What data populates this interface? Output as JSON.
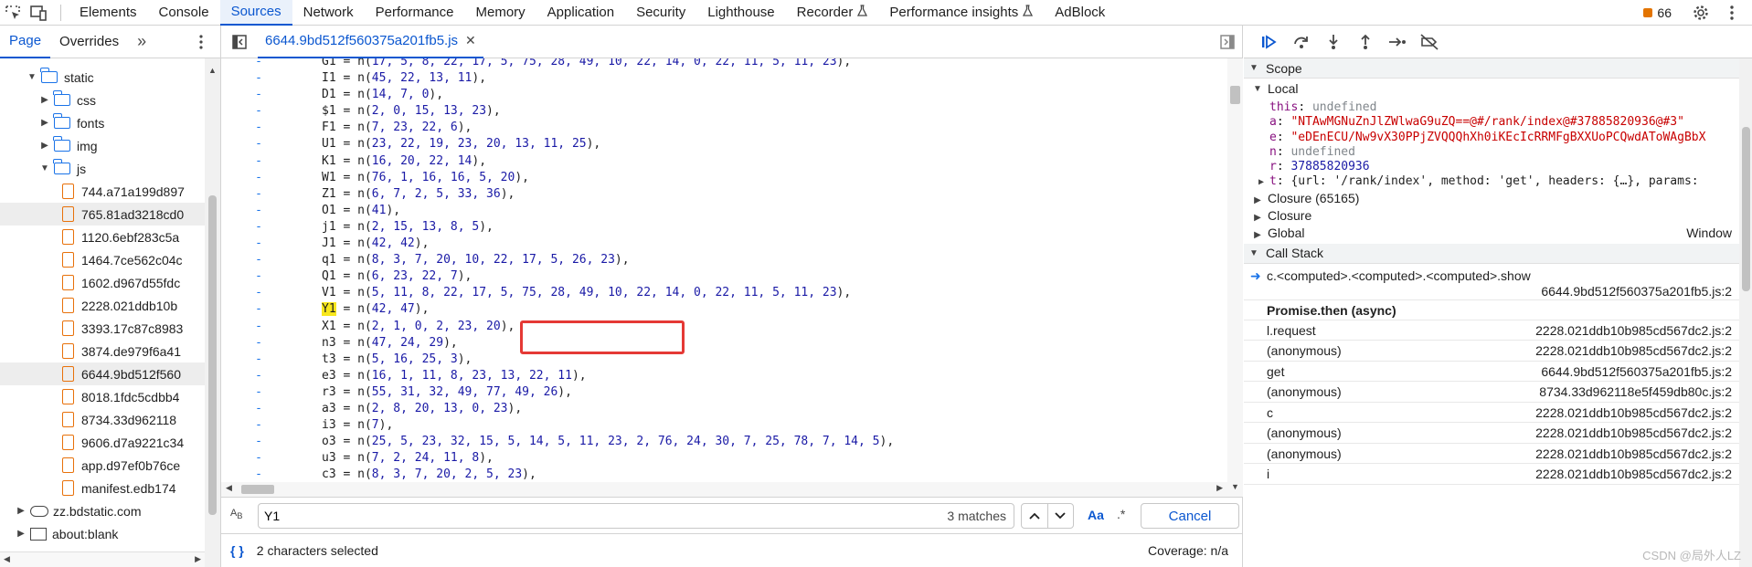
{
  "topbar": {
    "tabs": [
      "Elements",
      "Console",
      "Sources",
      "Network",
      "Performance",
      "Memory",
      "Application",
      "Security",
      "Lighthouse",
      "Recorder",
      "Performance insights",
      "AdBlock"
    ],
    "active_tab": "Sources",
    "issues_count": "66",
    "icons": [
      "inspect-element-icon",
      "device-toolbar-icon",
      "flask-icon",
      "gear-icon",
      "kebab-menu-icon"
    ]
  },
  "navigator": {
    "tabs": [
      "Page",
      "Overrides"
    ],
    "active_tab": "Page",
    "tree": [
      {
        "label": "static",
        "type": "folder",
        "depth": 1,
        "expanded": true
      },
      {
        "label": "css",
        "type": "folder",
        "depth": 2,
        "expanded": false
      },
      {
        "label": "fonts",
        "type": "folder",
        "depth": 2,
        "expanded": false
      },
      {
        "label": "img",
        "type": "folder",
        "depth": 2,
        "expanded": false
      },
      {
        "label": "js",
        "type": "folder",
        "depth": 2,
        "expanded": true
      },
      {
        "label": "744.a71a199d897",
        "type": "file",
        "depth": 3
      },
      {
        "label": "765.81ad3218cd0",
        "type": "file",
        "depth": 3,
        "highlight": true
      },
      {
        "label": "1120.6ebf283c5a",
        "type": "file",
        "depth": 3
      },
      {
        "label": "1464.7ce562c04c",
        "type": "file",
        "depth": 3
      },
      {
        "label": "1602.d967d55fdc",
        "type": "file",
        "depth": 3
      },
      {
        "label": "2228.021ddb10b",
        "type": "file",
        "depth": 3
      },
      {
        "label": "3393.17c87c8983",
        "type": "file",
        "depth": 3
      },
      {
        "label": "3874.de979f6a41",
        "type": "file",
        "depth": 3
      },
      {
        "label": "6644.9bd512f560",
        "type": "file",
        "depth": 3,
        "highlight": true
      },
      {
        "label": "8018.1fdc5cdbb4",
        "type": "file",
        "depth": 3
      },
      {
        "label": "8734.33d962118",
        "type": "file",
        "depth": 3
      },
      {
        "label": "9606.d7a9221c34",
        "type": "file",
        "depth": 3
      },
      {
        "label": "app.d97ef0b76ce",
        "type": "file",
        "depth": 3
      },
      {
        "label": "manifest.edb174",
        "type": "file",
        "depth": 3
      },
      {
        "label": "zz.bdstatic.com",
        "type": "cloud",
        "depth": 0,
        "expanded": false
      },
      {
        "label": "about:blank",
        "type": "frame",
        "depth": 0,
        "expanded": false
      }
    ]
  },
  "editor": {
    "file_tab": "6644.9bd512f560375a201fb5.js",
    "code_lines": [
      {
        "name": "G1",
        "args": "17, 5, 8, 22, 17, 5, 75, 28, 49, 10, 22, 14, 0, 22, 11, 5, 11, 23"
      },
      {
        "name": "I1",
        "args": "45, 22, 13, 11"
      },
      {
        "name": "D1",
        "args": "14, 7, 0"
      },
      {
        "name": "$1",
        "args": "2, 0, 15, 13, 23"
      },
      {
        "name": "F1",
        "args": "7, 23, 22, 6"
      },
      {
        "name": "U1",
        "args": "23, 22, 19, 23, 20, 13, 11, 25"
      },
      {
        "name": "K1",
        "args": "16, 20, 22, 14"
      },
      {
        "name": "W1",
        "args": "76, 1, 16, 16, 5, 20"
      },
      {
        "name": "Z1",
        "args": "6, 7, 2, 5, 33, 36"
      },
      {
        "name": "O1",
        "args": "41"
      },
      {
        "name": "j1",
        "args": "2, 15, 13, 8, 5"
      },
      {
        "name": "J1",
        "args": "42, 42"
      },
      {
        "name": "q1",
        "args": "8, 3, 7, 20, 10, 22, 17, 5, 26, 23"
      },
      {
        "name": "Q1",
        "args": "6, 23, 22, 7"
      },
      {
        "name": "V1",
        "args": "5, 11, 8, 22, 17, 5, 75, 28, 49, 10, 22, 14, 0, 22, 11, 5, 11, 23"
      },
      {
        "name": "Y1",
        "args": "42, 47",
        "highlight": true
      },
      {
        "name": "X1",
        "args": "2, 1, 0, 2, 23, 20"
      },
      {
        "name": "n3",
        "args": "47, 24, 29"
      },
      {
        "name": "t3",
        "args": "5, 16, 25, 3"
      },
      {
        "name": "e3",
        "args": "16, 1, 11, 8, 23, 13, 22, 11"
      },
      {
        "name": "r3",
        "args": "55, 31, 32, 49, 77, 49, 26"
      },
      {
        "name": "a3",
        "args": "2, 8, 20, 13, 0, 23"
      },
      {
        "name": "i3",
        "args": "7"
      },
      {
        "name": "o3",
        "args": "25, 5, 23, 32, 15, 5, 14, 5, 11, 23, 2, 76, 24, 30, 7, 25, 78, 7, 14, 5"
      },
      {
        "name": "u3",
        "args": "7, 2, 24, 11, 8"
      },
      {
        "name": "c3",
        "args": "8, 3, 7, 20, 2, 5, 23"
      }
    ],
    "gutter_marker": "-",
    "search": {
      "value": "Y1",
      "matches": "3 matches",
      "case_label": "Aa",
      "regex_label": ".*",
      "cancel_label": "Cancel"
    },
    "status": {
      "selection": "2 characters selected",
      "coverage": "Coverage: n/a"
    }
  },
  "debugger": {
    "scope": {
      "title": "Scope",
      "local_title": "Local",
      "vars": [
        {
          "key": "this",
          "value": "undefined",
          "kind": "undef"
        },
        {
          "key": "a",
          "value": "\"NTAwMGNuZnJlZWlwaG9uZQ==@#/rank/index@#37885820936@#3\"",
          "kind": "str"
        },
        {
          "key": "e",
          "value": "\"eDEnECU/Nw9vX30PPjZVQQQhXh0iKEcIcRRMFgBXXUoPCQwdAToWAgBbX",
          "kind": "str"
        },
        {
          "key": "n",
          "value": "undefined",
          "kind": "undef"
        },
        {
          "key": "r",
          "value": "37885820936",
          "kind": "num"
        },
        {
          "key": "t",
          "value": "{url: '/rank/index', method: 'get', headers: {…}, params:",
          "kind": "obj"
        }
      ],
      "closures": [
        "Closure (65165)",
        "Closure"
      ],
      "global_label": "Global",
      "global_value": "Window"
    },
    "call_stack": {
      "title": "Call Stack",
      "current": {
        "fn": "c.<computed>.<computed>.<computed>.show",
        "loc": "6644.9bd512f560375a201fb5.js:2"
      },
      "async_label": "Promise.then (async)",
      "frames": [
        {
          "fn": "l.request",
          "loc": "2228.021ddb10b985cd567dc2.js:2"
        },
        {
          "fn": "(anonymous)",
          "loc": "2228.021ddb10b985cd567dc2.js:2"
        },
        {
          "fn": "get",
          "loc": "6644.9bd512f560375a201fb5.js:2"
        },
        {
          "fn": "(anonymous)",
          "loc": "8734.33d962118e5f459db80c.js:2"
        },
        {
          "fn": "c",
          "loc": "2228.021ddb10b985cd567dc2.js:2"
        },
        {
          "fn": "(anonymous)",
          "loc": "2228.021ddb10b985cd567dc2.js:2"
        },
        {
          "fn": "(anonymous)",
          "loc": "2228.021ddb10b985cd567dc2.js:2"
        },
        {
          "fn": "i",
          "loc": "2228.021ddb10b985cd567dc2.js:2"
        }
      ]
    },
    "watermark": "CSDN @局外人LZ"
  },
  "colors": {
    "accent": "#0b57d0",
    "highlight": "#f8e71c",
    "annotation_box": "#e53935",
    "string": "#c80000",
    "number": "#1a1aa6"
  }
}
